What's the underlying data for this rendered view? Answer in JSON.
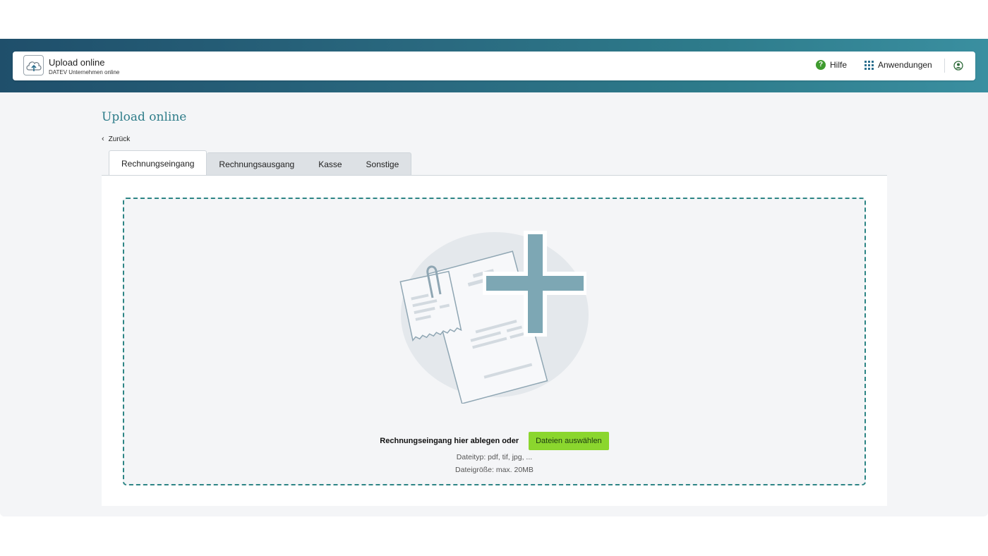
{
  "header": {
    "app_title": "Upload online",
    "app_subtitle": "DATEV Unternehmen online",
    "help_label": "Hilfe",
    "apps_label": "Anwendungen",
    "accent": "#2d7a8a"
  },
  "page": {
    "title": "Upload online",
    "back_label": "Zurück"
  },
  "tabs": [
    {
      "label": "Rechnungseingang",
      "active": true
    },
    {
      "label": "Rechnungsausgang",
      "active": false
    },
    {
      "label": "Kasse",
      "active": false
    },
    {
      "label": "Sonstige",
      "active": false
    }
  ],
  "dropzone": {
    "drop_text": "Rechnungseingang hier ablegen oder",
    "button_label": "Dateien auswählen",
    "filetypes": "Dateityp: pdf, tif, jpg, ...",
    "filesize": "Dateigröße: max. 20MB",
    "button_color": "#8bd62e",
    "border_color": "#2d8585"
  }
}
